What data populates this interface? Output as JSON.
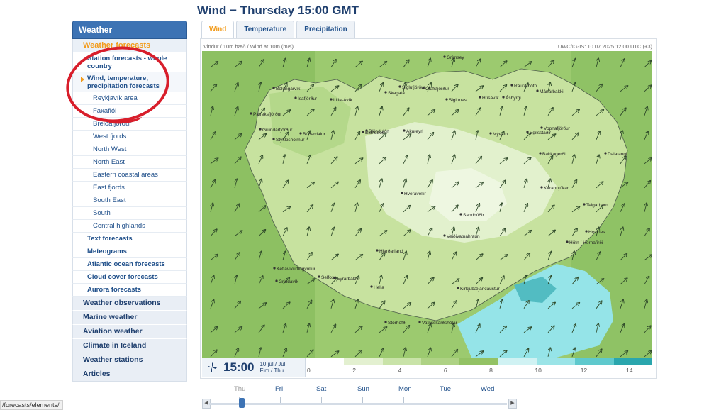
{
  "page": {
    "title": "Wind − Thursday 15:00 GMT"
  },
  "tabs": [
    {
      "label": "Wind",
      "active": true
    },
    {
      "label": "Temperature",
      "active": false
    },
    {
      "label": "Precipitation",
      "active": false
    }
  ],
  "sidebar": {
    "header": "Weather",
    "subheader": "Weather forecasts",
    "items": [
      {
        "label": "Station forecasts - whole country"
      },
      {
        "label": "Wind, temperature, precipitation forecasts",
        "active": true
      },
      {
        "label": "Reykjavík area"
      },
      {
        "label": "Faxaflói"
      },
      {
        "label": "Breiðafjörður"
      },
      {
        "label": "West fjords"
      },
      {
        "label": "North West"
      },
      {
        "label": "North East"
      },
      {
        "label": "Eastern coastal areas"
      },
      {
        "label": "East fjords"
      },
      {
        "label": "South East"
      },
      {
        "label": "South"
      },
      {
        "label": "Central highlands"
      },
      {
        "label": "Text forecasts"
      },
      {
        "label": "Meteograms"
      },
      {
        "label": "Atlantic ocean forecasts"
      },
      {
        "label": "Cloud cover forecasts"
      },
      {
        "label": "Aurora forecasts"
      }
    ],
    "main_sections": [
      {
        "label": "Weather observations"
      },
      {
        "label": "Marine weather"
      },
      {
        "label": "Aviation weather"
      },
      {
        "label": "Climate in Iceland"
      },
      {
        "label": "Weather stations"
      },
      {
        "label": "Articles"
      }
    ]
  },
  "map": {
    "caption_left": "Vindur / 10m hæð / Wind at 10m (m/s)",
    "caption_right": "UWC/IG-IS: 10.07.2025 12:00 UTC (+3)",
    "places": [
      "Grímsey",
      "Bolungarvík",
      "Ísafjörður",
      "Litla-Ávík",
      "Skagatá",
      "Siglufjörður",
      "Ólafsfjörður",
      "Siglunes",
      "Raufarhöfn",
      "Húsavík",
      "Ásbyrgi",
      "Mánárbakki",
      "Patreksfjörður",
      "Blönduós",
      "Akureyri",
      "Vopnafjörður",
      "Bakkagerði",
      "Dalatangi",
      "Búðardalur",
      "Egilsstaðir",
      "Stykkishólmur",
      "Mývatn",
      "Grundarfjörður",
      "Hveravellir",
      "Kárahnjúkar",
      "Teigarhorn",
      "Hvalnes",
      "Höfn í Hornafirði",
      "Veiðivatnahraun",
      "Sandbúðir",
      "Hjarðarland",
      "Kirkjubæjarklaustur",
      "Keflavíkurflugvöllur",
      "Grindavík",
      "Selfoss",
      "Hella",
      "Eyrarbakki",
      "Stórhöfði",
      "Vatnsskarðshólar",
      "Blöndulón"
    ],
    "colors": {
      "light": "#dcedbe",
      "mid": "#b6d98c",
      "dark": "#8fc265",
      "darker": "#6fac4c",
      "cyan": "#8fe6ea",
      "teal": "#4fbfc4"
    }
  },
  "legend": {
    "time": "15:00",
    "date_line1": "10.júl./ Jul",
    "date_line2": "Fim./ Thu",
    "ticks": [
      "0",
      "2",
      "4",
      "6",
      "8",
      "10",
      "12",
      "14"
    ],
    "colors": [
      "#ffffff",
      "#e3f0d0",
      "#c9e3a8",
      "#aed284",
      "#93c264",
      "#d0f2f3",
      "#9be4e7",
      "#5fc9cd",
      "#2aa6ad"
    ]
  },
  "days": [
    {
      "label": "Thu",
      "current": true
    },
    {
      "label": "Fri"
    },
    {
      "label": "Sat"
    },
    {
      "label": "Sun"
    },
    {
      "label": "Mon"
    },
    {
      "label": "Tue"
    },
    {
      "label": "Wed"
    }
  ],
  "status_url": "/forecasts/elements/"
}
